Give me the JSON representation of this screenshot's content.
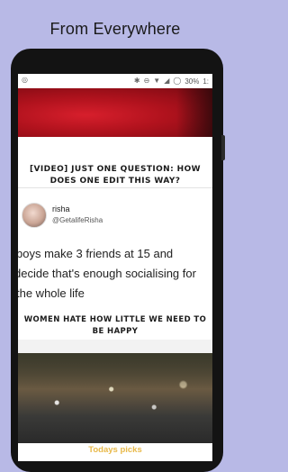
{
  "promo": {
    "headline": "From Everywhere"
  },
  "statusbar": {
    "battery_text": "30%",
    "clock_partial": "1:"
  },
  "feed": {
    "card1": {
      "title": "[VIDEO] JUST ONE QUESTION: HOW DOES ONE EDIT THIS WAY?"
    },
    "card2": {
      "author_name": "risha",
      "author_handle": "@GetalifeRisha",
      "tweet_lines": [
        "boys make 3 friends at 15 and",
        "decide that's enough socialising for",
        "the whole life"
      ],
      "title": "WOMEN HATE HOW LITTLE WE NEED TO BE HAPPY"
    },
    "card3": {
      "section_label": "Todays picks"
    }
  },
  "icons": {
    "status": [
      "bluetooth-icon",
      "dnd-icon",
      "wifi-icon",
      "signal-icon",
      "battery-icon"
    ],
    "avatar": "avatar"
  },
  "colors": {
    "background": "#b8b9e6",
    "accent": "#e8b94a"
  }
}
